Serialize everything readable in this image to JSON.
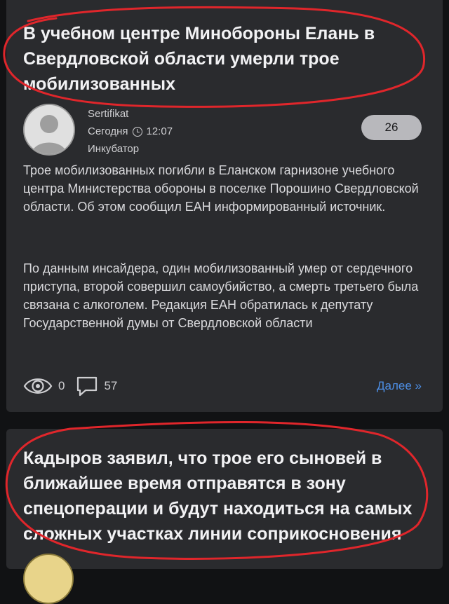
{
  "posts": [
    {
      "title": "В учебном центре Минобороны Елань в Свердловской области умерли трое мобилизованных",
      "author": "Sertifikat",
      "time_day": "Сегодня",
      "time_clock": "12:07",
      "community": "Инкубатор",
      "rating": "26",
      "paragraph1": "Трое мобилизованных погибли в Еланском гарнизоне учебного центра Министерства обороны в поселке Порошино Свердловской области. Об этом сообщил ЕАН информированный источник.",
      "paragraph2": "По данным инсайдера, один мобилизованный умер от сердечного приступа, второй совершил самоубийство, а смерть третьего была связана с алкоголем. Редакция ЕАН обратилась к депутату Государственной думы от Свердловской области",
      "views": "0",
      "comments": "57",
      "more_label": "Далее »"
    },
    {
      "title": "Кадыров заявил, что трое его сыновей в ближайшее время отправятся в зону спецоперации и будут находиться на самых сложных участках линии соприкосновения"
    }
  ],
  "icons": {
    "avatar": "default-user-icon",
    "clock": "clock-icon",
    "views": "eye-icon",
    "comments": "speech-bubble-icon"
  },
  "colors": {
    "background": "#111214",
    "card": "#2a2b2e",
    "link": "#4d8fe6",
    "annotation": "#e0262b",
    "badge": "#b8b8bc"
  }
}
